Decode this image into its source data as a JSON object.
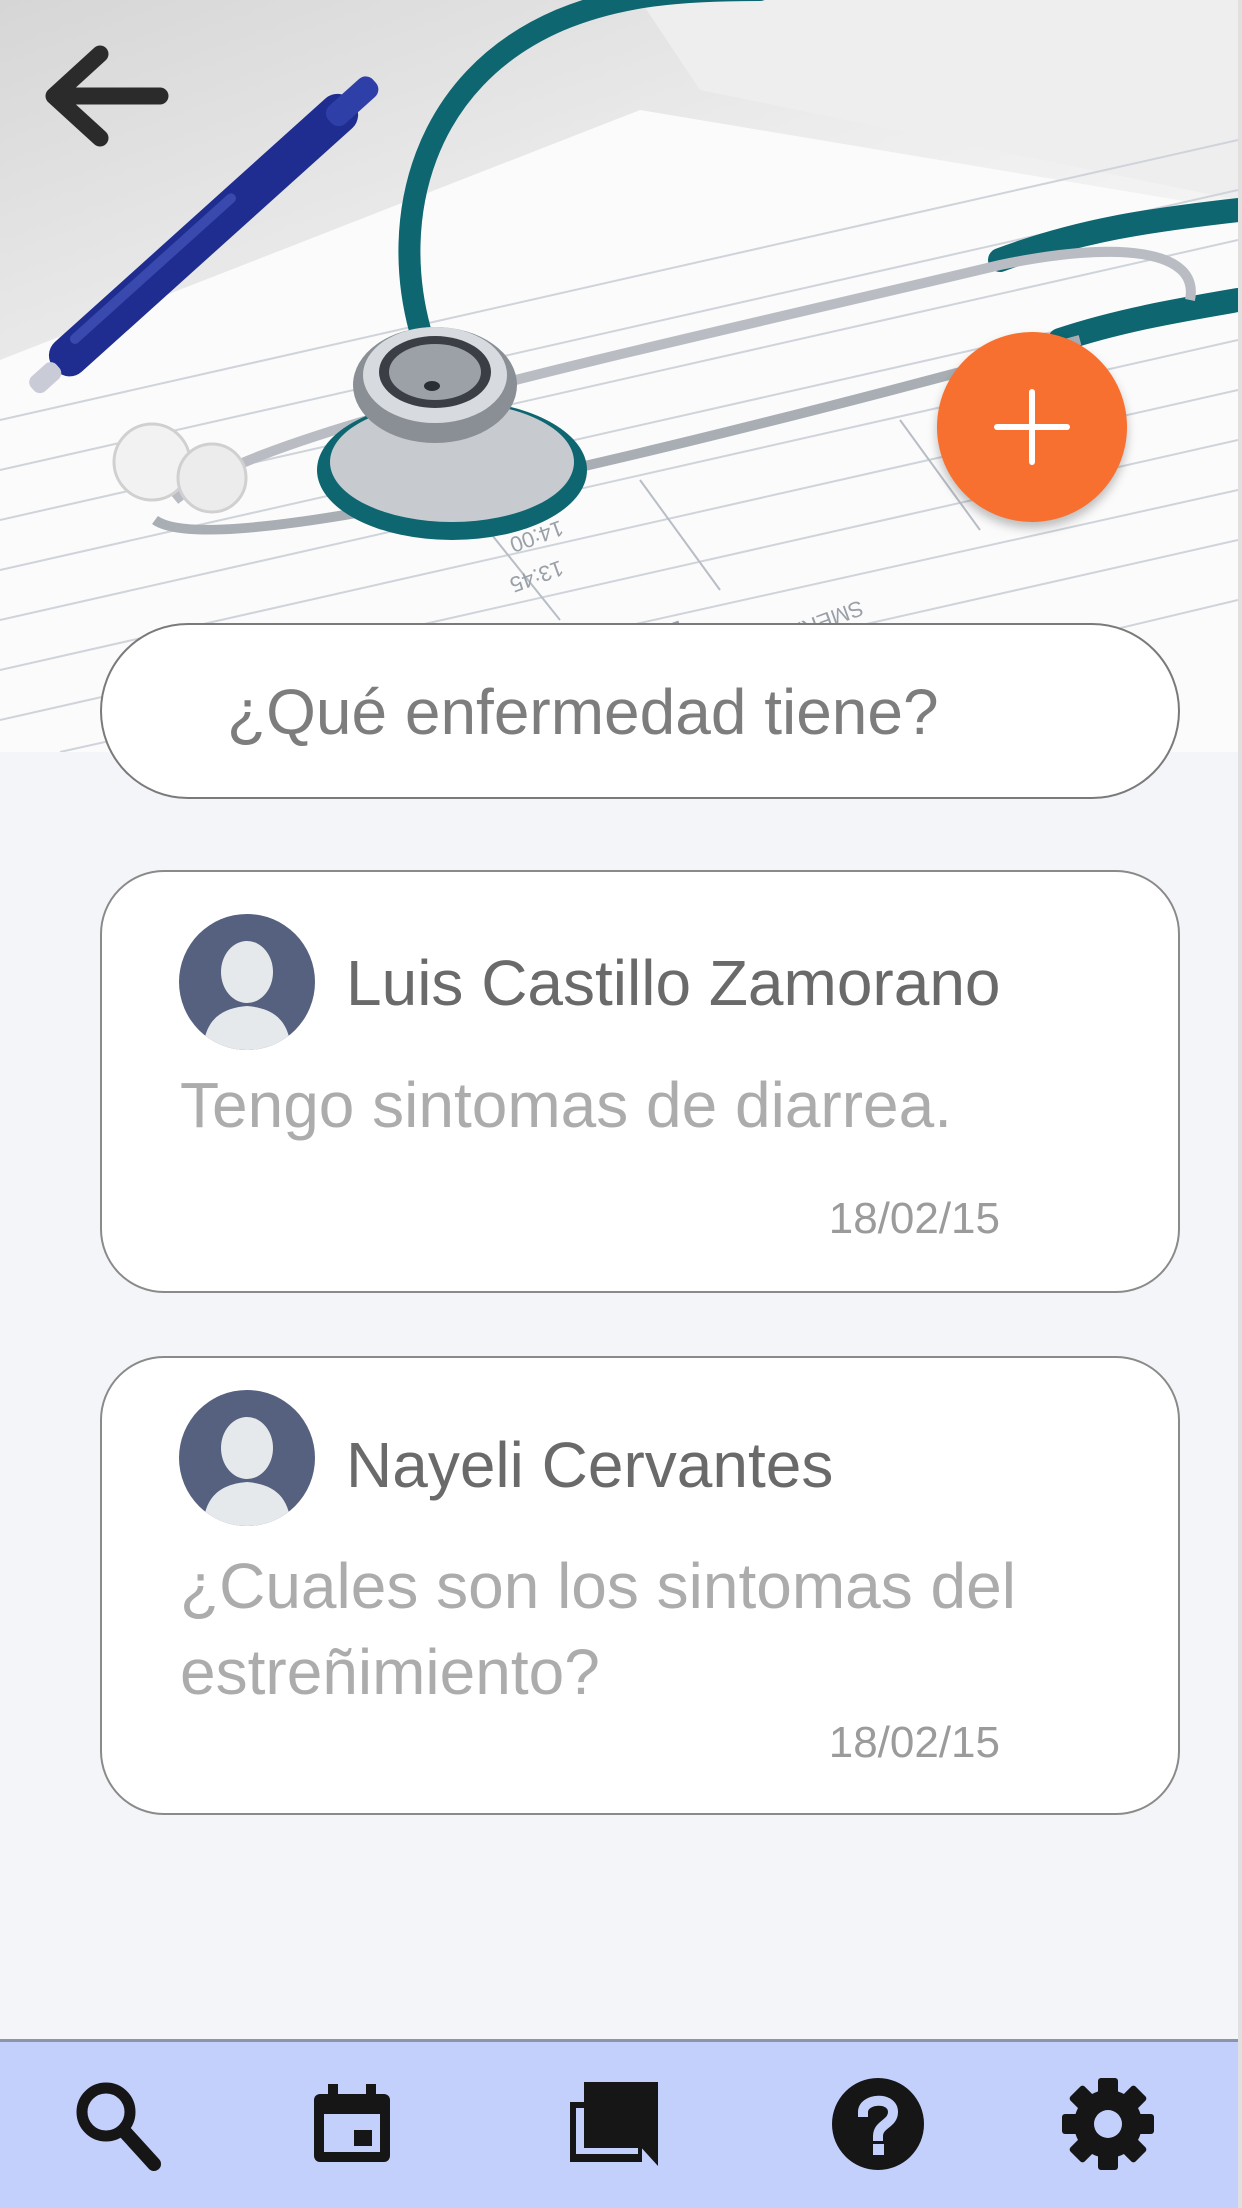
{
  "colors": {
    "accent": "#f7702f",
    "bottom_nav_bg": "#c4d0fc",
    "avatar_bg": "#56617f",
    "page_bg": "#f4f5f9"
  },
  "header": {
    "back_icon": "arrow-left-icon",
    "add_icon": "plus-icon"
  },
  "search": {
    "placeholder": "¿Qué enfermedad tiene?"
  },
  "posts": [
    {
      "author": "Luis Castillo Zamorano",
      "message": "Tengo sintomas de diarrea.",
      "date": "18/02/15",
      "avatar_icon": "user-avatar-icon"
    },
    {
      "author": "Nayeli Cervantes",
      "message": "¿Cuales son los sintomas del estreñimiento?",
      "date": "18/02/15",
      "avatar_icon": "user-avatar-icon"
    }
  ],
  "bottom_nav": {
    "items": [
      {
        "icon": "search-icon"
      },
      {
        "icon": "calendar-icon"
      },
      {
        "icon": "forum-icon"
      },
      {
        "icon": "help-icon"
      },
      {
        "icon": "gear-icon"
      }
    ]
  }
}
